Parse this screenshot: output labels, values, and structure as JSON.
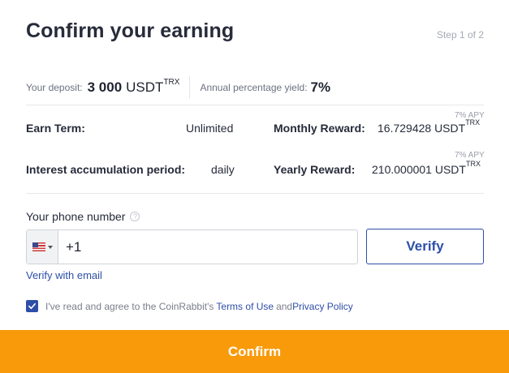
{
  "header": {
    "title": "Confirm your earning",
    "step": "Step 1 of 2"
  },
  "deposit": {
    "label": "Your deposit:",
    "amount": "3 000",
    "currency": "USDT",
    "network": "TRX"
  },
  "apy": {
    "label": "Annual percentage yield:",
    "value": "7%"
  },
  "terms": {
    "earn_term_label": "Earn Term:",
    "earn_term_value": "Unlimited",
    "interest_label": "Interest accumulation period:",
    "interest_value": "daily",
    "monthly_label": "Monthly Reward:",
    "monthly_apy": "7% APY",
    "monthly_value": "16.729428 USDT",
    "monthly_network": "TRX",
    "yearly_label": "Yearly Reward:",
    "yearly_apy": "7% APY",
    "yearly_value": "210.000001 USDT",
    "yearly_network": "TRX"
  },
  "phone": {
    "label": "Your phone number",
    "help_icon": "?",
    "country_icon": "us-flag-icon",
    "value": "+1",
    "verify_label": "Verify",
    "verify_email_label": "Verify with email"
  },
  "agreement": {
    "checked": true,
    "text_before": "I've read and agree to the CoinRabbit's",
    "terms_link": "Terms of Use",
    "and_text": "and",
    "privacy_link": "Privacy Policy"
  },
  "footer": {
    "confirm_label": "Confirm"
  },
  "colors": {
    "accent_blue": "#2e4fa8",
    "confirm_orange": "#f89a0a"
  }
}
